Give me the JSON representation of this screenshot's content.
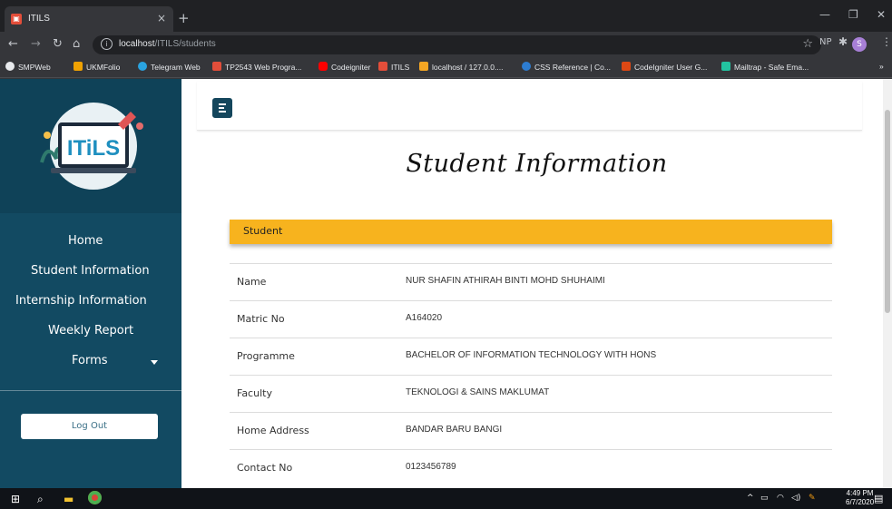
{
  "browser": {
    "tab_title": "ITILS",
    "tab_close": "×",
    "new_tab": "+",
    "url_host": "localhost",
    "url_path": "/ITILS/students",
    "ext_np": "NP",
    "profile_initial": "S",
    "bookmarks": [
      {
        "label": "SMPWeb",
        "color": "#ffffff"
      },
      {
        "label": "UKMFolio",
        "color": "#f0a202"
      },
      {
        "label": "Telegram Web",
        "color": "#2aa3e0"
      },
      {
        "label": "TP2543 Web Progra...",
        "color": "#e34e3a"
      },
      {
        "label": "Codeigniter",
        "color": "#ff0000"
      },
      {
        "label": "ITILS",
        "color": "#e34e3a"
      },
      {
        "label": "localhost / 127.0.0....",
        "color": "#f5a623"
      },
      {
        "label": "CSS Reference | Co...",
        "color": "#2d7dd2"
      },
      {
        "label": "CodeIgniter User G...",
        "color": "#dd4814"
      },
      {
        "label": "Mailtrap - Safe Ema...",
        "color": "#22c3a0"
      }
    ],
    "bookmarks_more": "»"
  },
  "sidebar": {
    "logo_text": "ITiLS",
    "items": [
      {
        "label": "Home"
      },
      {
        "label": "Student Information"
      },
      {
        "label": "Internship Information"
      },
      {
        "label": "Weekly Report"
      },
      {
        "label": "Forms"
      }
    ],
    "logout_label": "Log Out"
  },
  "main": {
    "page_title": "Student Information",
    "card_header": "Student",
    "rows": [
      {
        "label": "Name",
        "value": "NUR SHAFIN ATHIRAH BINTI MOHD SHUHAIMI"
      },
      {
        "label": "Matric No",
        "value": "A164020"
      },
      {
        "label": "Programme",
        "value": "BACHELOR OF INFORMATION TECHNOLOGY WITH HONS"
      },
      {
        "label": "Faculty",
        "value": "TEKNOLOGI & SAINS MAKLUMAT"
      },
      {
        "label": "Home Address",
        "value": "BANDAR BARU BANGI"
      },
      {
        "label": "Contact No",
        "value": "0123456789"
      }
    ]
  },
  "taskbar": {
    "time": "4:49 PM",
    "date": "6/7/2020"
  },
  "colors": {
    "sidebar": "#124a62",
    "accent": "#f7b31e",
    "hamburger": "#14465c"
  }
}
